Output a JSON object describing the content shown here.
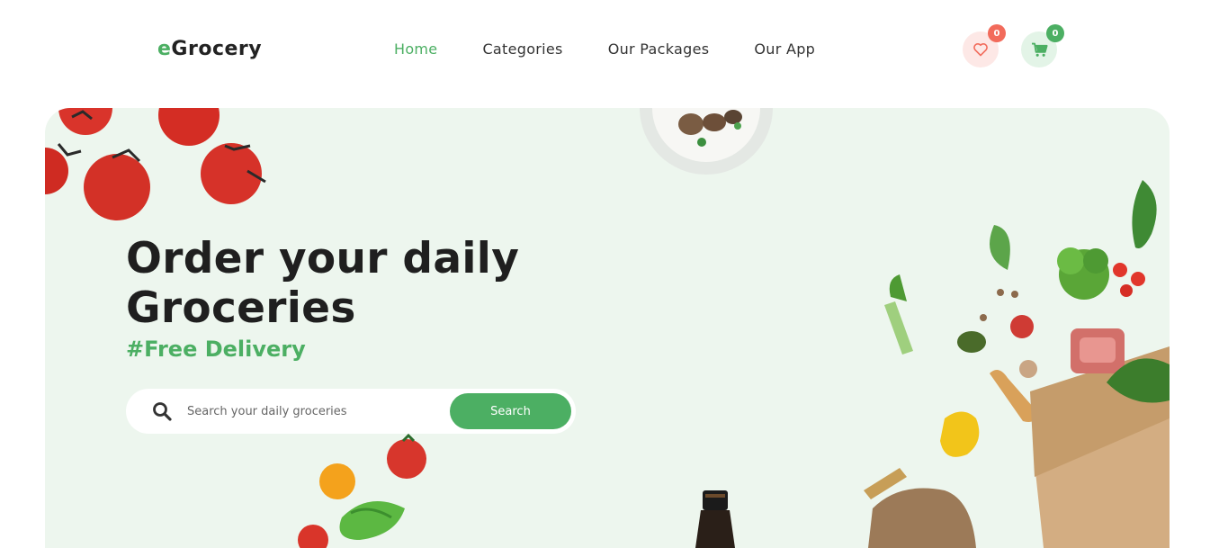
{
  "brand": {
    "prefix": "e",
    "name": "Grocery"
  },
  "nav": [
    {
      "label": "Home",
      "active": true
    },
    {
      "label": "Categories",
      "active": false
    },
    {
      "label": "Our Packages",
      "active": false
    },
    {
      "label": "Our App",
      "active": false
    }
  ],
  "header_actions": {
    "wishlist_count": "0",
    "cart_count": "0"
  },
  "hero": {
    "headline_line1": "Order your daily",
    "headline_line2": "Groceries",
    "tagline": "#Free Delivery",
    "search_placeholder": "Search your daily groceries",
    "search_button": "Search"
  },
  "colors": {
    "accent": "#4caf63",
    "badge_red": "#f26b5b",
    "hero_bg": "#edf6ee"
  }
}
